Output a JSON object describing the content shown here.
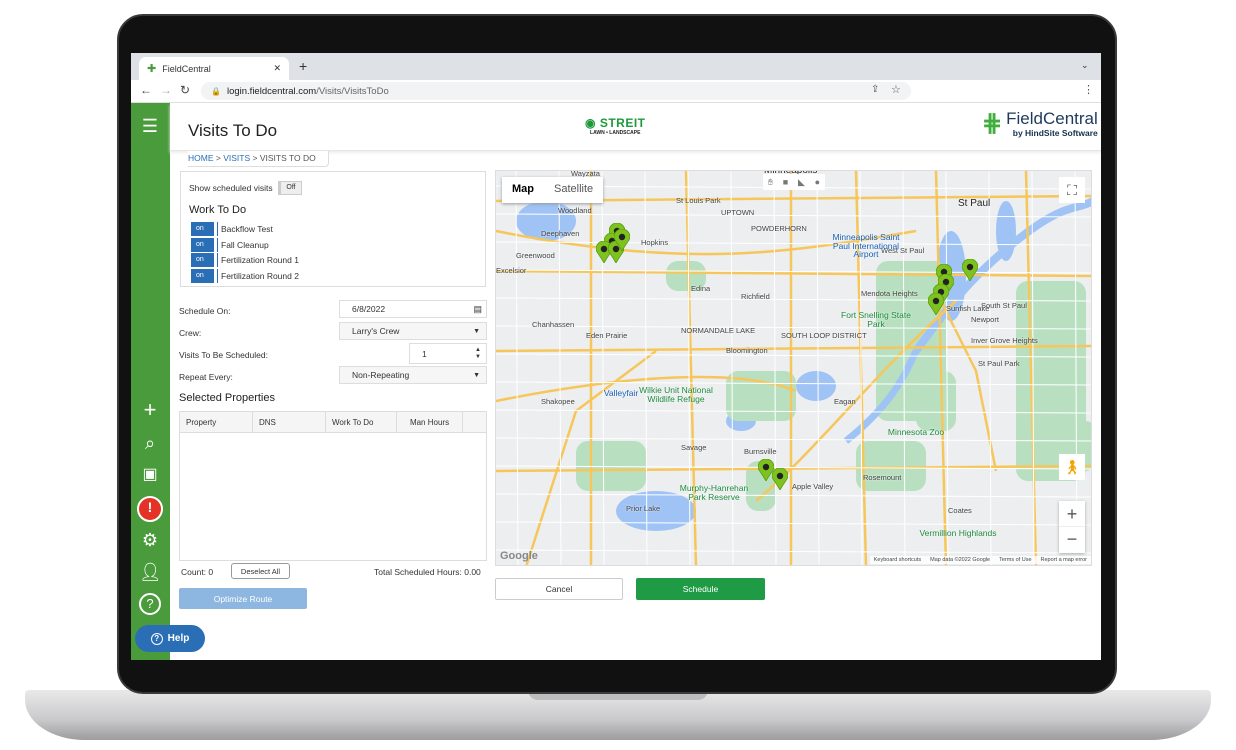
{
  "browser": {
    "tab_title": "FieldCentral",
    "url_domain": "login.fieldcentral.com",
    "url_path": "/Visits/VisitsToDo"
  },
  "header": {
    "title": "Visits To Do",
    "breadcrumb": [
      "HOME",
      "VISITS",
      "VISITS TO DO"
    ],
    "client_logo": "STREIT",
    "client_logo_sub": "LAWN • LANDSCAPE",
    "brand": "FieldCentral",
    "brand_sub": "by HindSite Software"
  },
  "sidebar": {
    "items": [
      "menu-icon",
      "add-icon",
      "search-icon",
      "calendar-add-icon",
      "alert-icon",
      "gear-icon",
      "user-icon",
      "help-icon"
    ],
    "help_label": "Help",
    "accent": "#4a9b3c"
  },
  "filters": {
    "show_scheduled_label": "Show scheduled visits",
    "show_scheduled_value": "Off",
    "work_heading": "Work To Do",
    "work_items": [
      {
        "label": "Backflow Test",
        "state": "on"
      },
      {
        "label": "Fall Cleanup",
        "state": "on"
      },
      {
        "label": "Fertilization Round 1",
        "state": "on"
      },
      {
        "label": "Fertilization Round 2",
        "state": "on"
      }
    ]
  },
  "form": {
    "schedule_on_label": "Schedule On:",
    "schedule_on_value": "6/8/2022",
    "crew_label": "Crew:",
    "crew_value": "Larry's Crew",
    "visits_label": "Visits To Be Scheduled:",
    "visits_value": "1",
    "repeat_label": "Repeat Every:",
    "repeat_value": "Non-Repeating"
  },
  "properties": {
    "heading": "Selected Properties",
    "columns": [
      "Property",
      "DNS",
      "Work To Do",
      "Man Hours"
    ],
    "rows": [],
    "count_label": "Count: 0",
    "deselect_label": "Deselect All",
    "total_label": "Total Scheduled Hours: 0.00",
    "optimize_label": "Optimize Route"
  },
  "map": {
    "type_tabs": [
      "Map",
      "Satellite"
    ],
    "active_tab": "Map",
    "labels": [
      "Minneapolis",
      "Wayzata",
      "St Louis Park",
      "UPTOWN",
      "POWDERHORN",
      "St Paul",
      "Woodland",
      "Deephaven",
      "Hopkins",
      "Greenwood",
      "Excelsior",
      "West St Paul",
      "Minneapolis Saint Paul International Airport",
      "Edina",
      "Richfield",
      "Mendota Heights",
      "Sunfish Lake",
      "South St Paul",
      "Newport",
      "Chanhassen",
      "Eden Prairie",
      "Fort Snelling State Park",
      "NORMANDALE LAKE",
      "SOUTH LOOP DISTRICT",
      "Inver Grove Heights",
      "Bloomington",
      "St Paul Park",
      "Valleyfair",
      "Wilkie Unit National Wildlife Refuge",
      "Shakopee",
      "Eagan",
      "Minnesota Zoo",
      "Savage",
      "Burnsville",
      "Rosemount",
      "Apple Valley",
      "Murphy-Hanrehan Park Reserve",
      "Prior Lake",
      "Coates",
      "Vermillion Highlands"
    ],
    "footer": [
      "Keyboard shortcuts",
      "Map data ©2022 Google",
      "Terms of Use",
      "Report a map error"
    ],
    "google": "Google",
    "marker_color": "#7dc21e"
  },
  "actions": {
    "cancel_label": "Cancel",
    "schedule_label": "Schedule",
    "schedule_color": "#1f9a45"
  }
}
